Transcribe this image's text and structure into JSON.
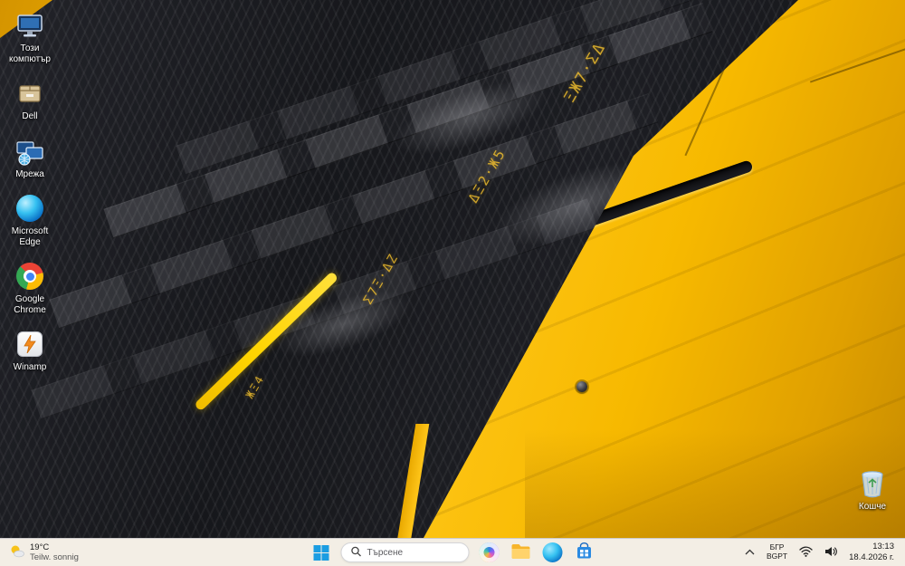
{
  "desktop": {
    "icons": [
      {
        "label": "Този компютър"
      },
      {
        "label": "Dell"
      },
      {
        "label": "Мрежа"
      },
      {
        "label": "Microsoft Edge"
      },
      {
        "label": "Google Chrome"
      },
      {
        "label": "Winamp"
      },
      {
        "label": "Кошче"
      }
    ]
  },
  "wallpaper": {
    "graffiti": [
      "ΞЖ7·ΣΔ",
      "ΔΞ2·Ж5",
      "Σ7Ξ·ΔΖ",
      "ЖΞ4"
    ],
    "colors": {
      "yellow": "#f5b500",
      "black": "#16171b",
      "accent": "#ffd400"
    }
  },
  "taskbar": {
    "weather": {
      "temp": "19°C",
      "condition": "Teilw. sonnig"
    },
    "search": {
      "placeholder": "Търсене"
    },
    "tray": {
      "lang_line1": "БГР",
      "lang_line2": "BGPT",
      "time": "13:13",
      "date": "18.4.2026 г."
    }
  }
}
